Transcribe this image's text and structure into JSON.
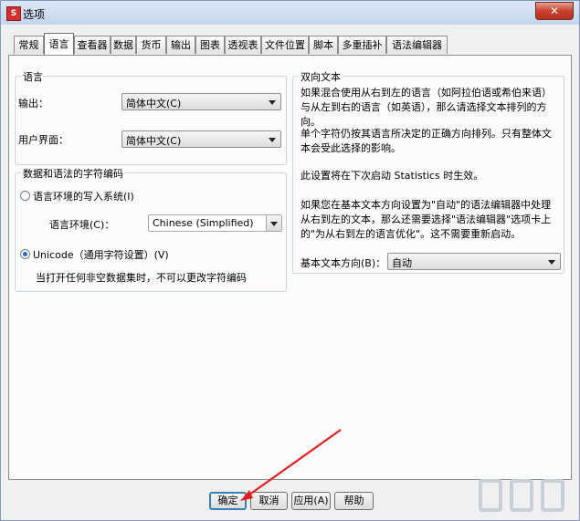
{
  "window": {
    "title": "选项",
    "app_icon": "spss-app-icon",
    "close_icon": "close-icon"
  },
  "tabs": [
    {
      "label": "常规"
    },
    {
      "label": "语言",
      "active": true
    },
    {
      "label": "查看器"
    },
    {
      "label": "数据"
    },
    {
      "label": "货币"
    },
    {
      "label": "输出"
    },
    {
      "label": "图表"
    },
    {
      "label": "透视表"
    },
    {
      "label": "文件位置"
    },
    {
      "label": "脚本"
    },
    {
      "label": "多重插补"
    },
    {
      "label": "语法编辑器"
    }
  ],
  "language_group": {
    "title": "语言",
    "output_label": "输出：",
    "output_value": "简体中文(C)",
    "ui_label": "用户界面：",
    "ui_value": "简体中文(C)"
  },
  "encoding_group": {
    "title": "数据和语法的字符编码",
    "locale_radio": "语言环境的写入系统(I)",
    "locale_label": "语言环境(C)：",
    "locale_value": "Chinese (Simplified)",
    "unicode_radio": "Unicode（通用字符设置）(V)",
    "note": "当打开任何非空数据集时，不可以更改字符编码"
  },
  "bidi_group": {
    "title": "双向文本",
    "para1": "如果混合使用从右到左的语言（如阿拉伯语或希伯来语）与从左到右的语言（如英语），那么请选择文本排列的方向。",
    "para2": "单个字符仍按其语言所决定的正确方向排列。只有整体文本会受此选择的影响。",
    "para3": "此设置将在下次启动 Statistics 时生效。",
    "para4": "如果您在基本文本方向设置为\"自动\"的语法编辑器中处理从右到左的文本，那么还需要选择\"语法编辑器\"选项卡上的\"为从右到左的语言优化\"。这不需要重新启动。",
    "direction_label": "基本文本方向(B)：",
    "direction_value": "自动"
  },
  "buttons": {
    "ok": "确定",
    "cancel": "取消",
    "apply": "应用(A)",
    "help": "帮助"
  },
  "colors": {
    "accent": "#3c7fb1",
    "annotation_arrow": "#e02020"
  }
}
